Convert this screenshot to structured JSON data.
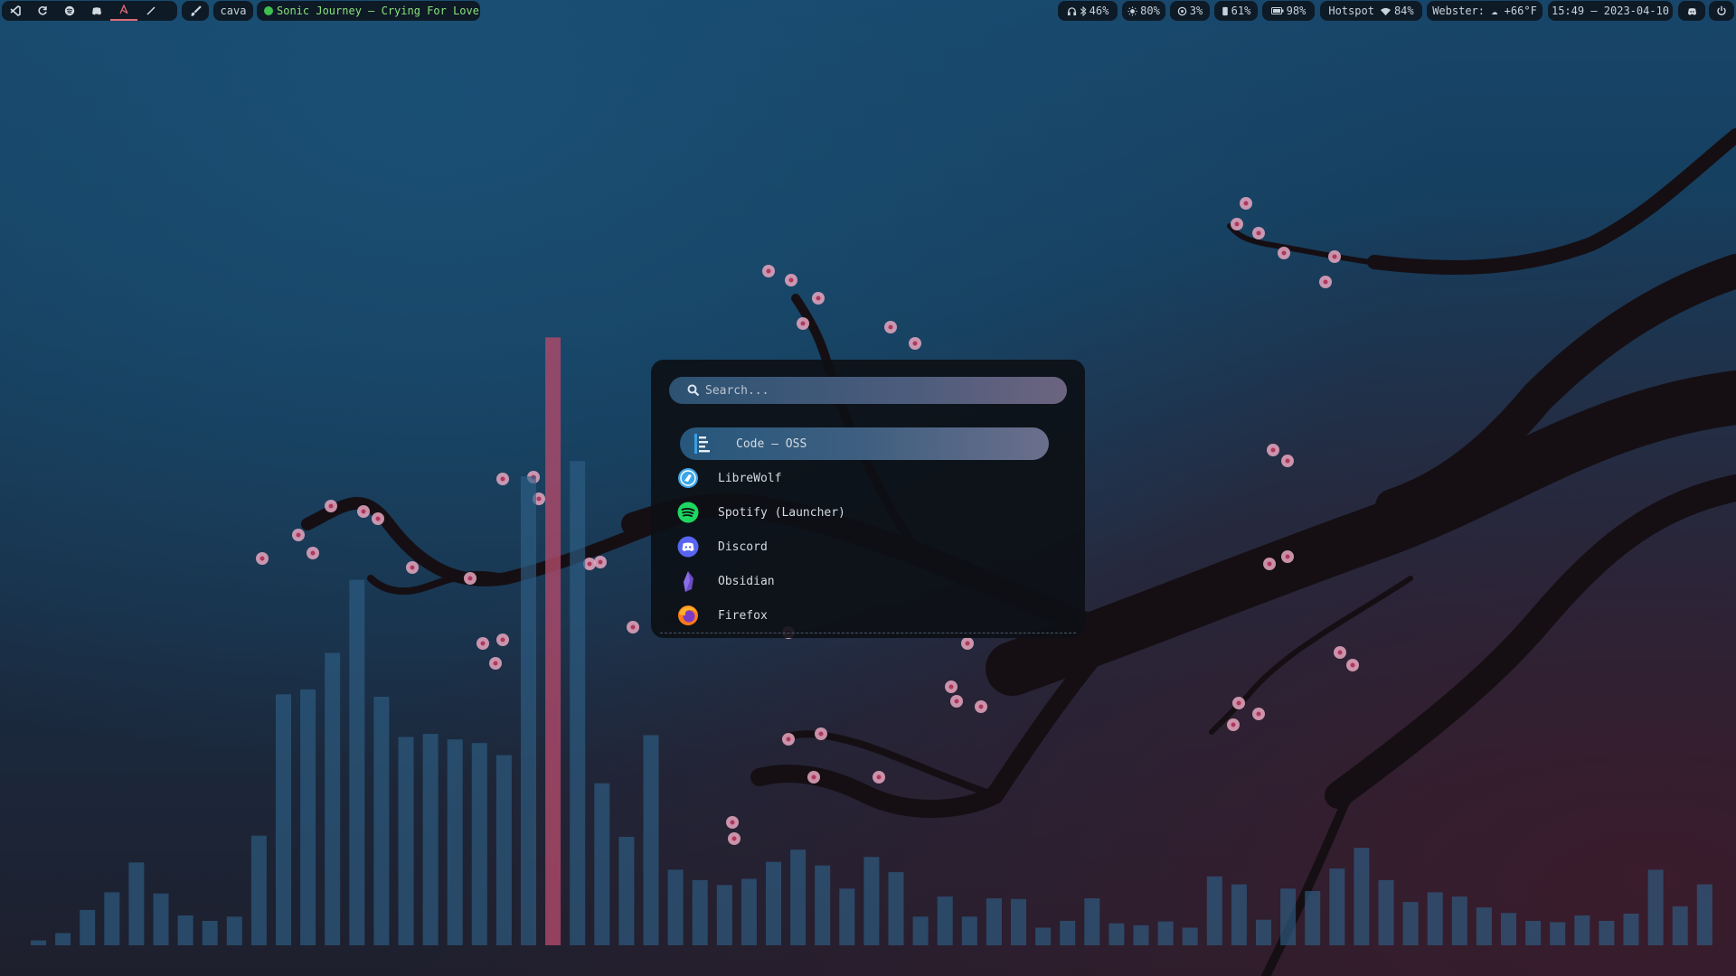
{
  "colors": {
    "bar_bg": "#0e1a26",
    "media_green": "#88e07a",
    "accent_red": "#e06c75",
    "visualizer_blue": "#2e5f86",
    "visualizer_pink": "#b04a6a",
    "blossom": "#e7a7bf"
  },
  "topbar": {
    "workspaces": [
      {
        "icon": "vscode-icon"
      },
      {
        "icon": "refresh-icon"
      },
      {
        "icon": "spotify-icon"
      },
      {
        "icon": "discord-icon"
      },
      {
        "icon": "obsidian-icon",
        "active": true
      },
      {
        "icon": "pen-icon"
      }
    ],
    "brush_icon": "brush-icon",
    "cava_label": "cava",
    "media": {
      "status_icon": "spotify-status-icon",
      "track": "Sonic Journey — Crying For Love"
    },
    "stats": {
      "headphones": "46%",
      "brightness": "80%",
      "cpu": "3%",
      "memory": "61%",
      "battery": "98%",
      "network": "Hotspot",
      "wifi": "84%",
      "weather": "Webster: ☁ +66°F",
      "datetime": "15:49 — 2023-04-10"
    },
    "discord_tray_icon": "discord-icon",
    "power_icon": "power-icon"
  },
  "launcher": {
    "search_placeholder": "Search...",
    "search_value": "",
    "apps": [
      {
        "label": "Code — OSS",
        "icon": "vscode-icon",
        "selected": true
      },
      {
        "label": "LibreWolf",
        "icon": "librewolf-icon"
      },
      {
        "label": "Spotify (Launcher)",
        "icon": "spotify-icon"
      },
      {
        "label": "Discord",
        "icon": "discord-icon"
      },
      {
        "label": "Obsidian",
        "icon": "obsidian-icon"
      },
      {
        "label": "Firefox",
        "icon": "firefox-icon"
      }
    ]
  },
  "visualizer": {
    "levels": [
      0.008,
      0.02,
      0.058,
      0.087,
      0.136,
      0.085,
      0.049,
      0.04,
      0.047,
      0.18,
      0.412,
      0.42,
      0.48,
      0.6,
      0.408,
      0.342,
      0.347,
      0.338,
      0.332,
      0.312,
      0.77,
      0.998,
      0.795,
      0.266,
      0.178,
      0.345,
      0.124,
      0.107,
      0.099,
      0.109,
      0.137,
      0.157,
      0.131,
      0.093,
      0.145,
      0.12,
      0.047,
      0.08,
      0.047,
      0.077,
      0.076,
      0.029,
      0.04,
      0.077,
      0.036,
      0.033,
      0.039,
      0.029,
      0.113,
      0.1,
      0.042,
      0.093,
      0.089,
      0.126,
      0.16,
      0.107,
      0.071,
      0.087,
      0.08,
      0.062,
      0.053,
      0.04,
      0.038,
      0.049,
      0.04,
      0.052,
      0.124,
      0.064,
      0.1
    ],
    "highlight_index": 21
  }
}
